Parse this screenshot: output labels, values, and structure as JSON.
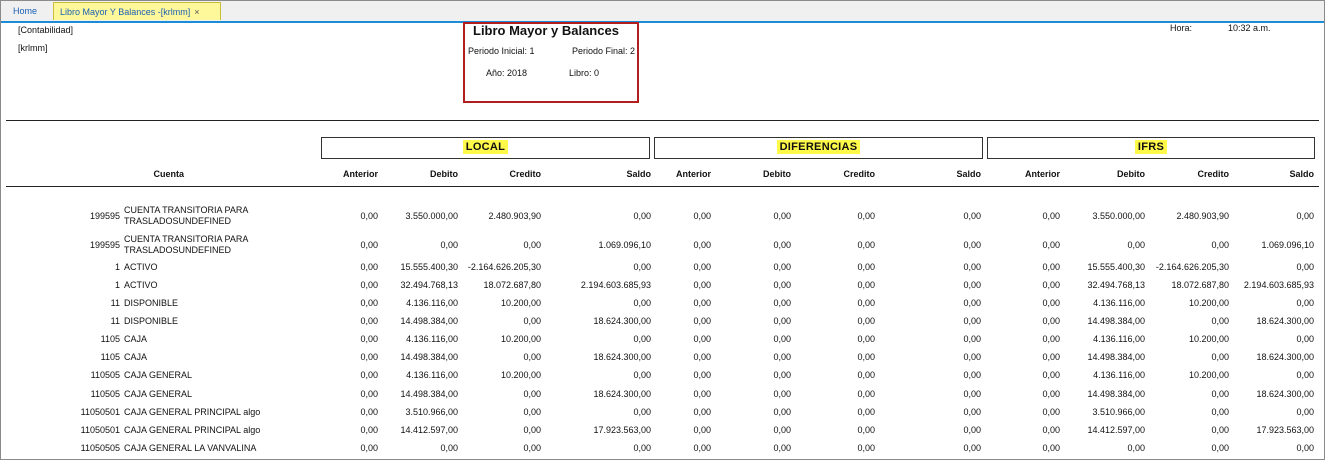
{
  "tabs": {
    "home": "Home",
    "active": "Libro Mayor Y Balances -[krlmm]",
    "close_glyph": "×"
  },
  "report": {
    "module": "[Contabilidad]",
    "user": "[krlmm]",
    "title": "Libro Mayor y Balances",
    "periodo_inicial": "Periodo Inicial: 1",
    "periodo_final": "Periodo Final: 2",
    "anio": "Año: 2018",
    "libro": "Libro: 0",
    "hora_label": "Hora:",
    "hora_value": "10:32 a.m."
  },
  "groups": [
    "LOCAL",
    "DIFERENCIAS",
    "IFRS"
  ],
  "columns": {
    "cuenta": "Cuenta",
    "sub": [
      "Anterior",
      "Debito",
      "Credito",
      "Saldo"
    ]
  },
  "rows": [
    {
      "code": "199595",
      "name": "CUENTA TRANSITORIA PARA TRASLADOSUNDEFINED",
      "v": [
        "0,00",
        "3.550.000,00",
        "2.480.903,90",
        "0,00",
        "0,00",
        "0,00",
        "0,00",
        "0,00",
        "0,00",
        "3.550.000,00",
        "2.480.903,90",
        "0,00"
      ]
    },
    {
      "code": "199595",
      "name": "CUENTA TRANSITORIA PARA TRASLADOSUNDEFINED",
      "v": [
        "0,00",
        "0,00",
        "0,00",
        "1.069.096,10",
        "0,00",
        "0,00",
        "0,00",
        "0,00",
        "0,00",
        "0,00",
        "0,00",
        "1.069.096,10"
      ]
    },
    {
      "code": "1",
      "name": "ACTIVO",
      "v": [
        "0,00",
        "15.555.400,30",
        "-2.164.626.205,30",
        "0,00",
        "0,00",
        "0,00",
        "0,00",
        "0,00",
        "0,00",
        "15.555.400,30",
        "-2.164.626.205,30",
        "0,00"
      ]
    },
    {
      "code": "1",
      "name": "ACTIVO",
      "v": [
        "0,00",
        "32.494.768,13",
        "18.072.687,80",
        "2.194.603.685,93",
        "0,00",
        "0,00",
        "0,00",
        "0,00",
        "0,00",
        "32.494.768,13",
        "18.072.687,80",
        "2.194.603.685,93"
      ]
    },
    {
      "code": "11",
      "name": "DISPONIBLE",
      "v": [
        "0,00",
        "4.136.116,00",
        "10.200,00",
        "0,00",
        "0,00",
        "0,00",
        "0,00",
        "0,00",
        "0,00",
        "4.136.116,00",
        "10.200,00",
        "0,00"
      ]
    },
    {
      "code": "11",
      "name": "DISPONIBLE",
      "v": [
        "0,00",
        "14.498.384,00",
        "0,00",
        "18.624.300,00",
        "0,00",
        "0,00",
        "0,00",
        "0,00",
        "0,00",
        "14.498.384,00",
        "0,00",
        "18.624.300,00"
      ]
    },
    {
      "code": "1105",
      "name": "CAJA",
      "v": [
        "0,00",
        "4.136.116,00",
        "10.200,00",
        "0,00",
        "0,00",
        "0,00",
        "0,00",
        "0,00",
        "0,00",
        "4.136.116,00",
        "10.200,00",
        "0,00"
      ]
    },
    {
      "code": "1105",
      "name": "CAJA",
      "v": [
        "0,00",
        "14.498.384,00",
        "0,00",
        "18.624.300,00",
        "0,00",
        "0,00",
        "0,00",
        "0,00",
        "0,00",
        "14.498.384,00",
        "0,00",
        "18.624.300,00"
      ]
    },
    {
      "code": "110505",
      "name": "CAJA GENERAL",
      "v": [
        "0,00",
        "4.136.116,00",
        "10.200,00",
        "0,00",
        "0,00",
        "0,00",
        "0,00",
        "0,00",
        "0,00",
        "4.136.116,00",
        "10.200,00",
        "0,00"
      ]
    },
    {
      "code": "110505",
      "name": "CAJA GENERAL",
      "v": [
        "0,00",
        "14.498.384,00",
        "0,00",
        "18.624.300,00",
        "0,00",
        "0,00",
        "0,00",
        "0,00",
        "0,00",
        "14.498.384,00",
        "0,00",
        "18.624.300,00"
      ]
    },
    {
      "code": "11050501",
      "name": "CAJA GENERAL PRINCIPAL algo",
      "v": [
        "0,00",
        "3.510.966,00",
        "0,00",
        "0,00",
        "0,00",
        "0,00",
        "0,00",
        "0,00",
        "0,00",
        "3.510.966,00",
        "0,00",
        "0,00"
      ]
    },
    {
      "code": "11050501",
      "name": "CAJA GENERAL PRINCIPAL algo",
      "v": [
        "0,00",
        "14.412.597,00",
        "0,00",
        "17.923.563,00",
        "0,00",
        "0,00",
        "0,00",
        "0,00",
        "0,00",
        "14.412.597,00",
        "0,00",
        "17.923.563,00"
      ]
    },
    {
      "code": "11050505",
      "name": "CAJA GENERAL LA VANVALINA",
      "v": [
        "0,00",
        "0,00",
        "0,00",
        "0,00",
        "0,00",
        "0,00",
        "0,00",
        "0,00",
        "0,00",
        "0,00",
        "0,00",
        "0,00"
      ]
    }
  ]
}
